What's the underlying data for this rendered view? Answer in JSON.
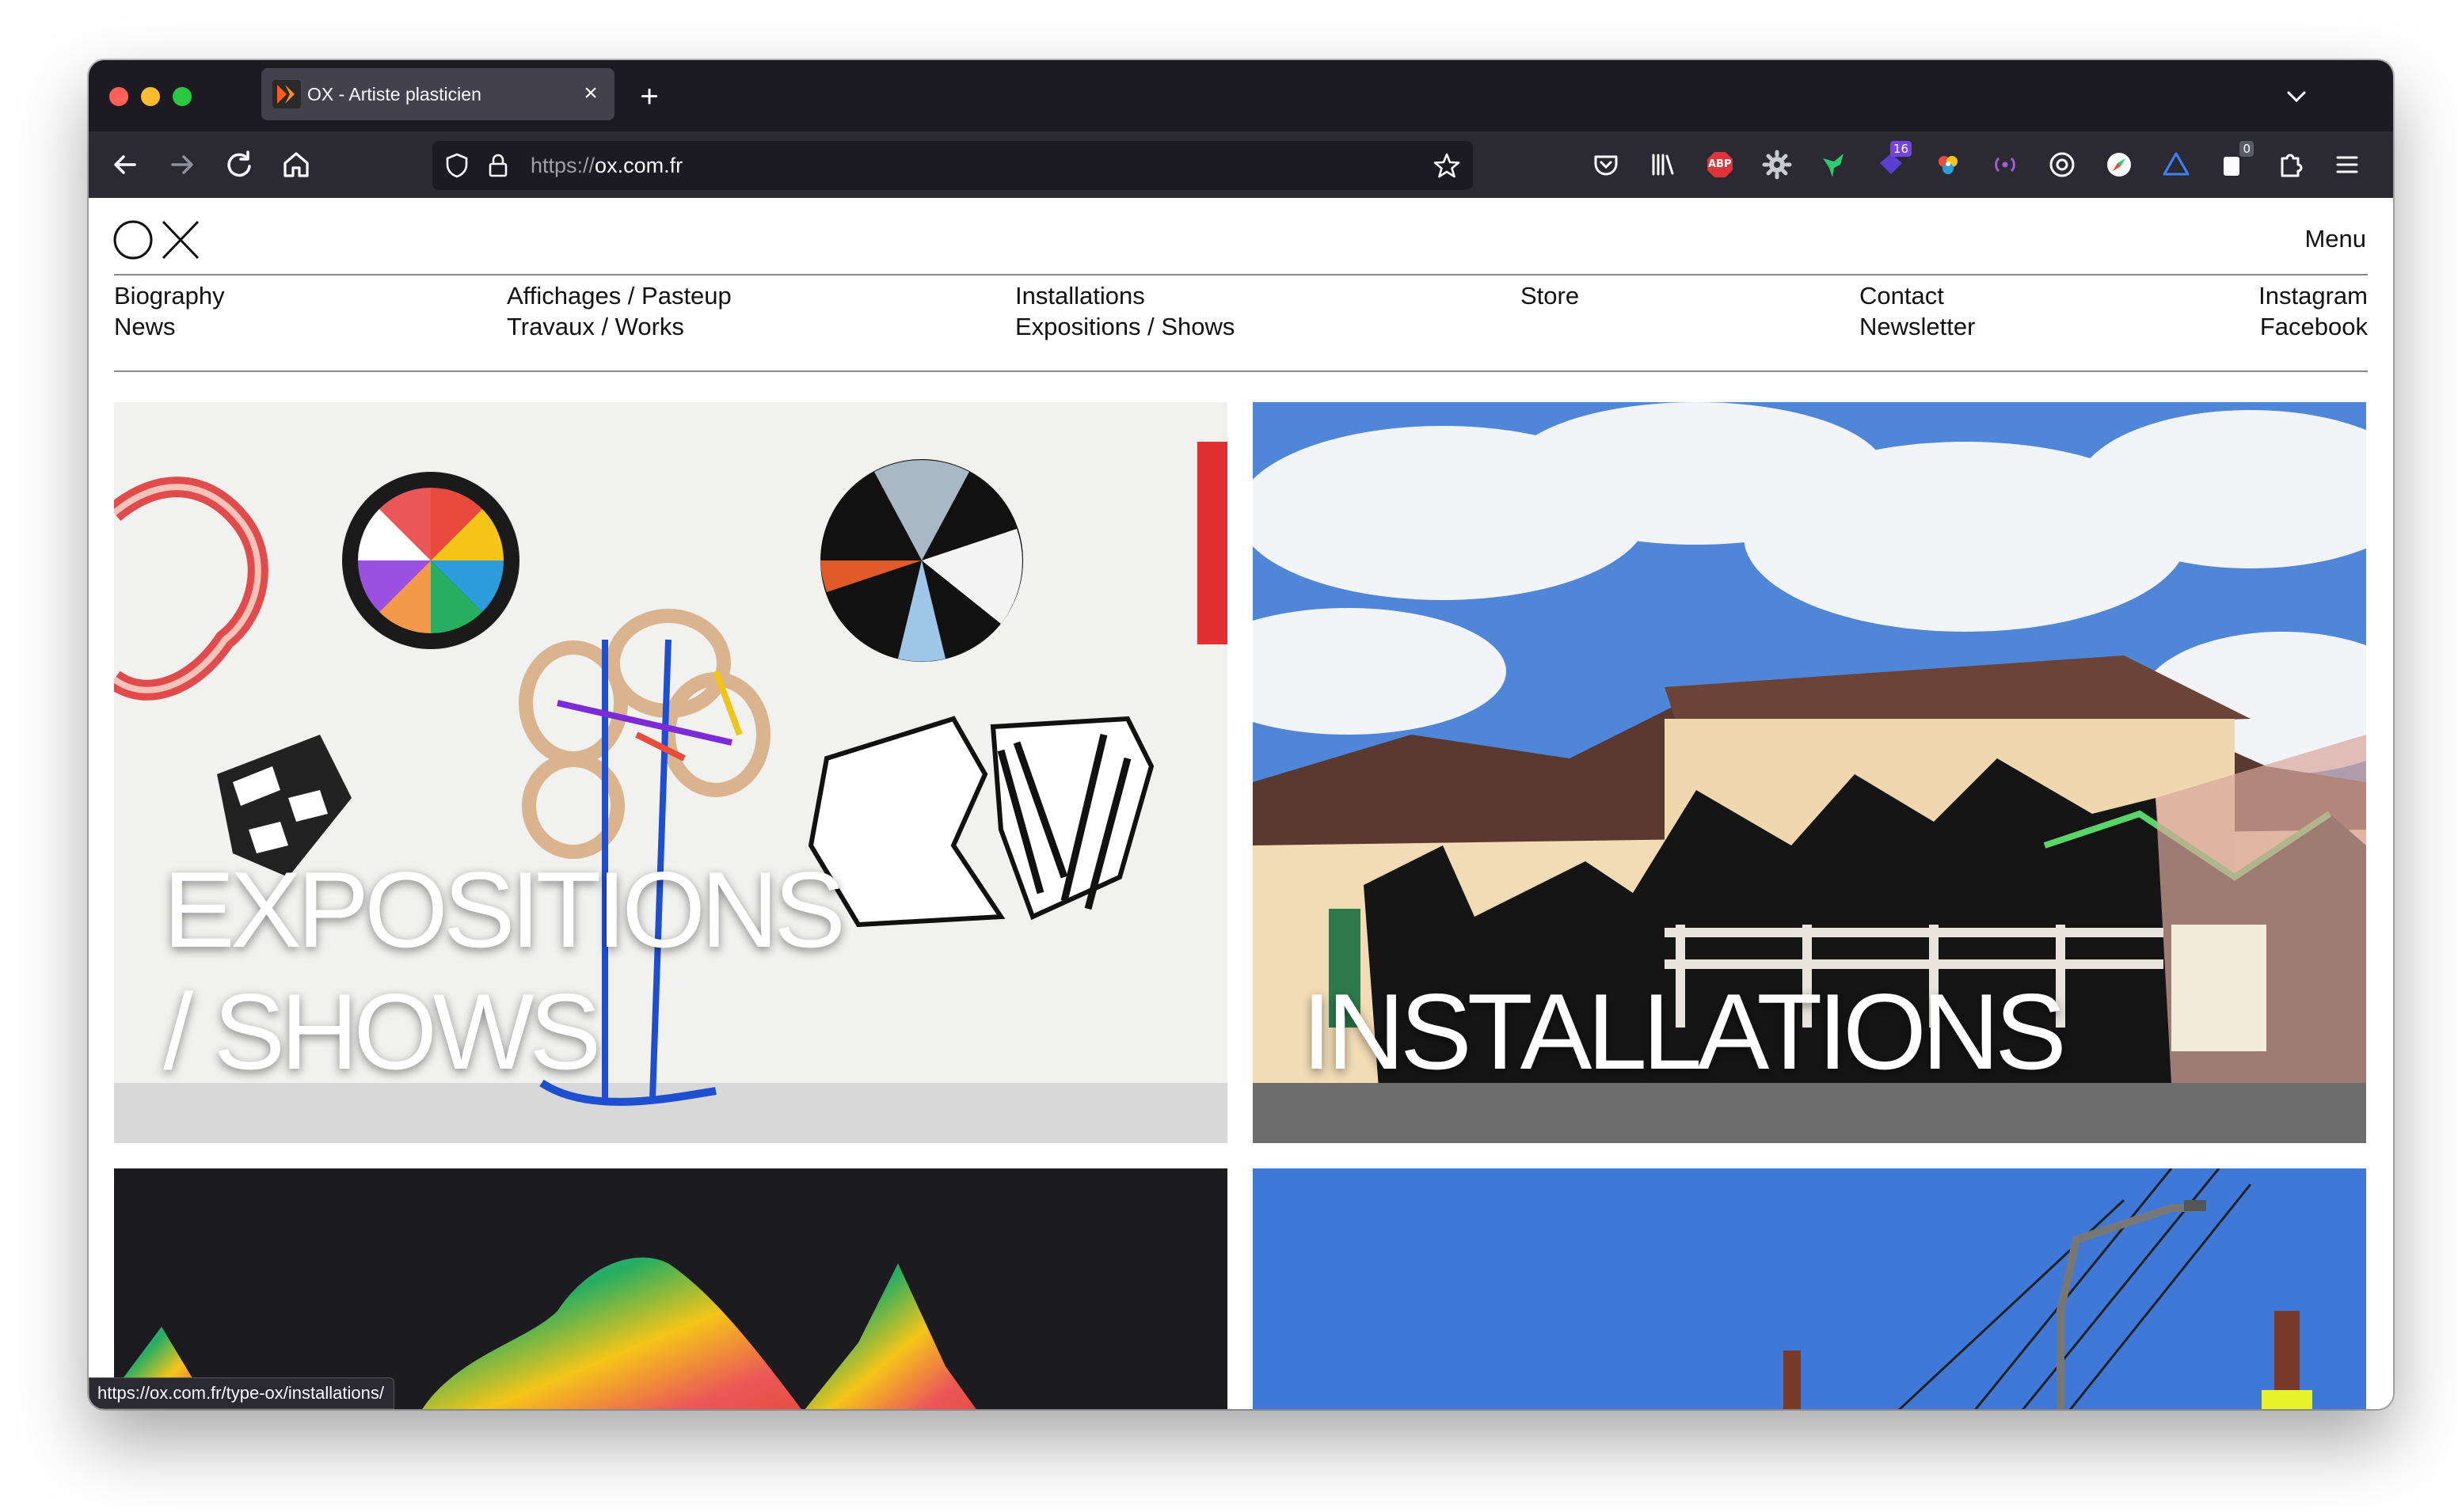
{
  "browser": {
    "tab": {
      "title": "OX - Artiste plasticien"
    },
    "url": {
      "scheme": "https://",
      "host": "ox.com.fr"
    },
    "extensions": {
      "downloads_badge": "16",
      "counter_badge": "0",
      "adblock_label": "ABP"
    },
    "status_url": "https://ox.com.fr/type-ox/installations/"
  },
  "site": {
    "logo": "OX",
    "menu_label": "Menu",
    "nav": {
      "biography": "Biography",
      "news": "News",
      "affichages": "Affichages / Pasteup",
      "travaux": "Travaux / Works",
      "installations": "Installations",
      "expositions": "Expositions / Shows",
      "store": "Store",
      "contact": "Contact",
      "newsletter": "Newsletter",
      "instagram": "Instagram",
      "facebook": "Facebook"
    },
    "tiles": {
      "expositions_line1": "EXPOSITIONS",
      "expositions_line2": "/ SHOWS",
      "installations": "INSTALLATIONS"
    }
  },
  "colors": {
    "tabbar": "#1c1b22",
    "toolbar": "#2b2a33",
    "sky": "#3f78d6"
  }
}
